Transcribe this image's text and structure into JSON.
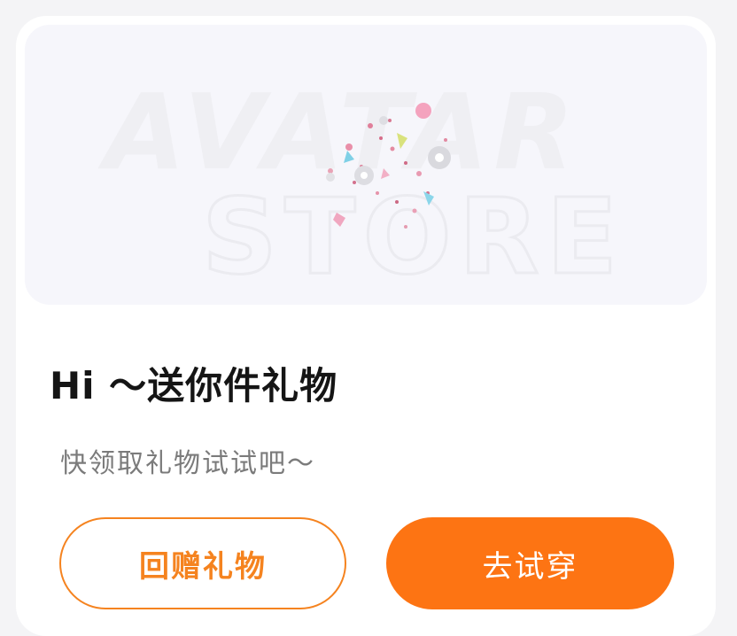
{
  "banner": {
    "image": "avatar-store-illustration",
    "text_line1": "AVATAR",
    "text_line2": "STORE"
  },
  "gift": {
    "title": "Hi ～送你件礼物",
    "subtitle": "快领取礼物试试吧～"
  },
  "actions": {
    "return_gift_label": "回赠礼物",
    "try_on_label": "去试穿"
  },
  "colors": {
    "accent": "#fd7413",
    "outline": "#f5831f",
    "banner_bg": "#f6f6fb"
  }
}
